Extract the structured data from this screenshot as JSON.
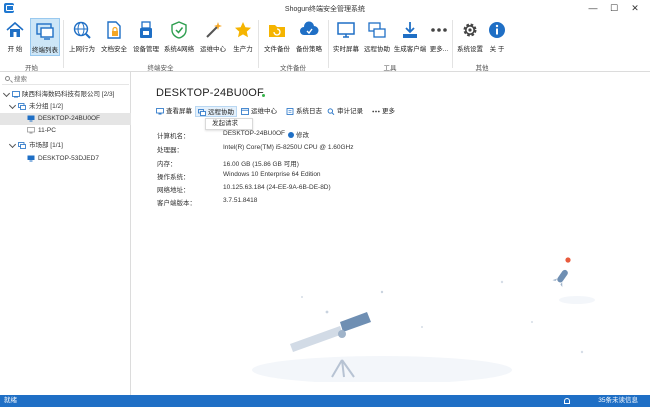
{
  "window": {
    "title": "Shogun终端安全管理系统",
    "buttons": [
      "—",
      "☐",
      "✕"
    ]
  },
  "ribbon": {
    "buttons": [
      {
        "label": "开 始",
        "icon": "home-icon"
      },
      {
        "label": "终端列表",
        "icon": "monitor-list-icon",
        "active": true
      },
      {
        "label": "上网行为",
        "icon": "globe-search-icon"
      },
      {
        "label": "文档安全",
        "icon": "document-lock-icon"
      },
      {
        "label": "设备管理",
        "icon": "usb-device-icon"
      },
      {
        "label": "系统&网络",
        "icon": "shield-network-icon"
      },
      {
        "label": "运维中心",
        "icon": "wand-icon"
      },
      {
        "label": "生产力",
        "icon": "star-icon"
      },
      {
        "label": "文件备份",
        "icon": "folder-backup-icon"
      },
      {
        "label": "备份策略",
        "icon": "cloud-policy-icon"
      },
      {
        "label": "实时屏幕",
        "icon": "realtime-screen-icon"
      },
      {
        "label": "远程协助",
        "icon": "remote-assist-icon"
      },
      {
        "label": "生成客户端",
        "icon": "download-client-icon"
      },
      {
        "label": "更多...",
        "icon": "more-dots-icon"
      },
      {
        "label": "系统设置",
        "icon": "gear-icon"
      },
      {
        "label": "关 于",
        "icon": "info-icon"
      }
    ],
    "groups": [
      "开始",
      "终端安全",
      "文件备份",
      "工具",
      "其他"
    ]
  },
  "sidebar": {
    "search_placeholder": "搜索",
    "tree": [
      {
        "label": "陕西科海数码科技有限公司 [2/3]",
        "type": "company"
      },
      {
        "label": "未分组 [1/2]",
        "type": "group"
      },
      {
        "label": "DESKTOP-24BU0OF",
        "type": "device",
        "online": true,
        "selected": true
      },
      {
        "label": "11-PC",
        "type": "device",
        "online": false
      },
      {
        "label": "市场部 [1/1]",
        "type": "group"
      },
      {
        "label": "DESKTOP-53DJED7",
        "type": "device",
        "online": true
      }
    ]
  },
  "device": {
    "name": "DESKTOP-24BU0OF",
    "actions": [
      "查看屏幕",
      "远程协助",
      "运维中心",
      "系统日志",
      "审计记录",
      "更多"
    ],
    "dropdown_item": "发起请求",
    "edit_label": "修改",
    "info": [
      {
        "label": "计算机名：",
        "value": "DESKTOP-24BU0OF"
      },
      {
        "label": "处理器：",
        "value": "Intel(R) Core(TM) i5-8250U CPU @ 1.60GHz"
      },
      {
        "label": "内存：",
        "value": "16.00 GB (15.86 GB 可用)"
      },
      {
        "label": "操作系统：",
        "value": "Windows 10 Enterprise 64 Edition"
      },
      {
        "label": "网络地址：",
        "value": "10.125.63.184  (24-EE-9A-6B-DE-8D)"
      },
      {
        "label": "客户端版本：",
        "value": "3.7.51.8418"
      }
    ]
  },
  "status": {
    "left": "就绪",
    "right": "35条未读信息"
  },
  "colors": {
    "accent": "#1f6fc5",
    "selected_bg": "#cde6f7",
    "online": "#35b34a"
  }
}
